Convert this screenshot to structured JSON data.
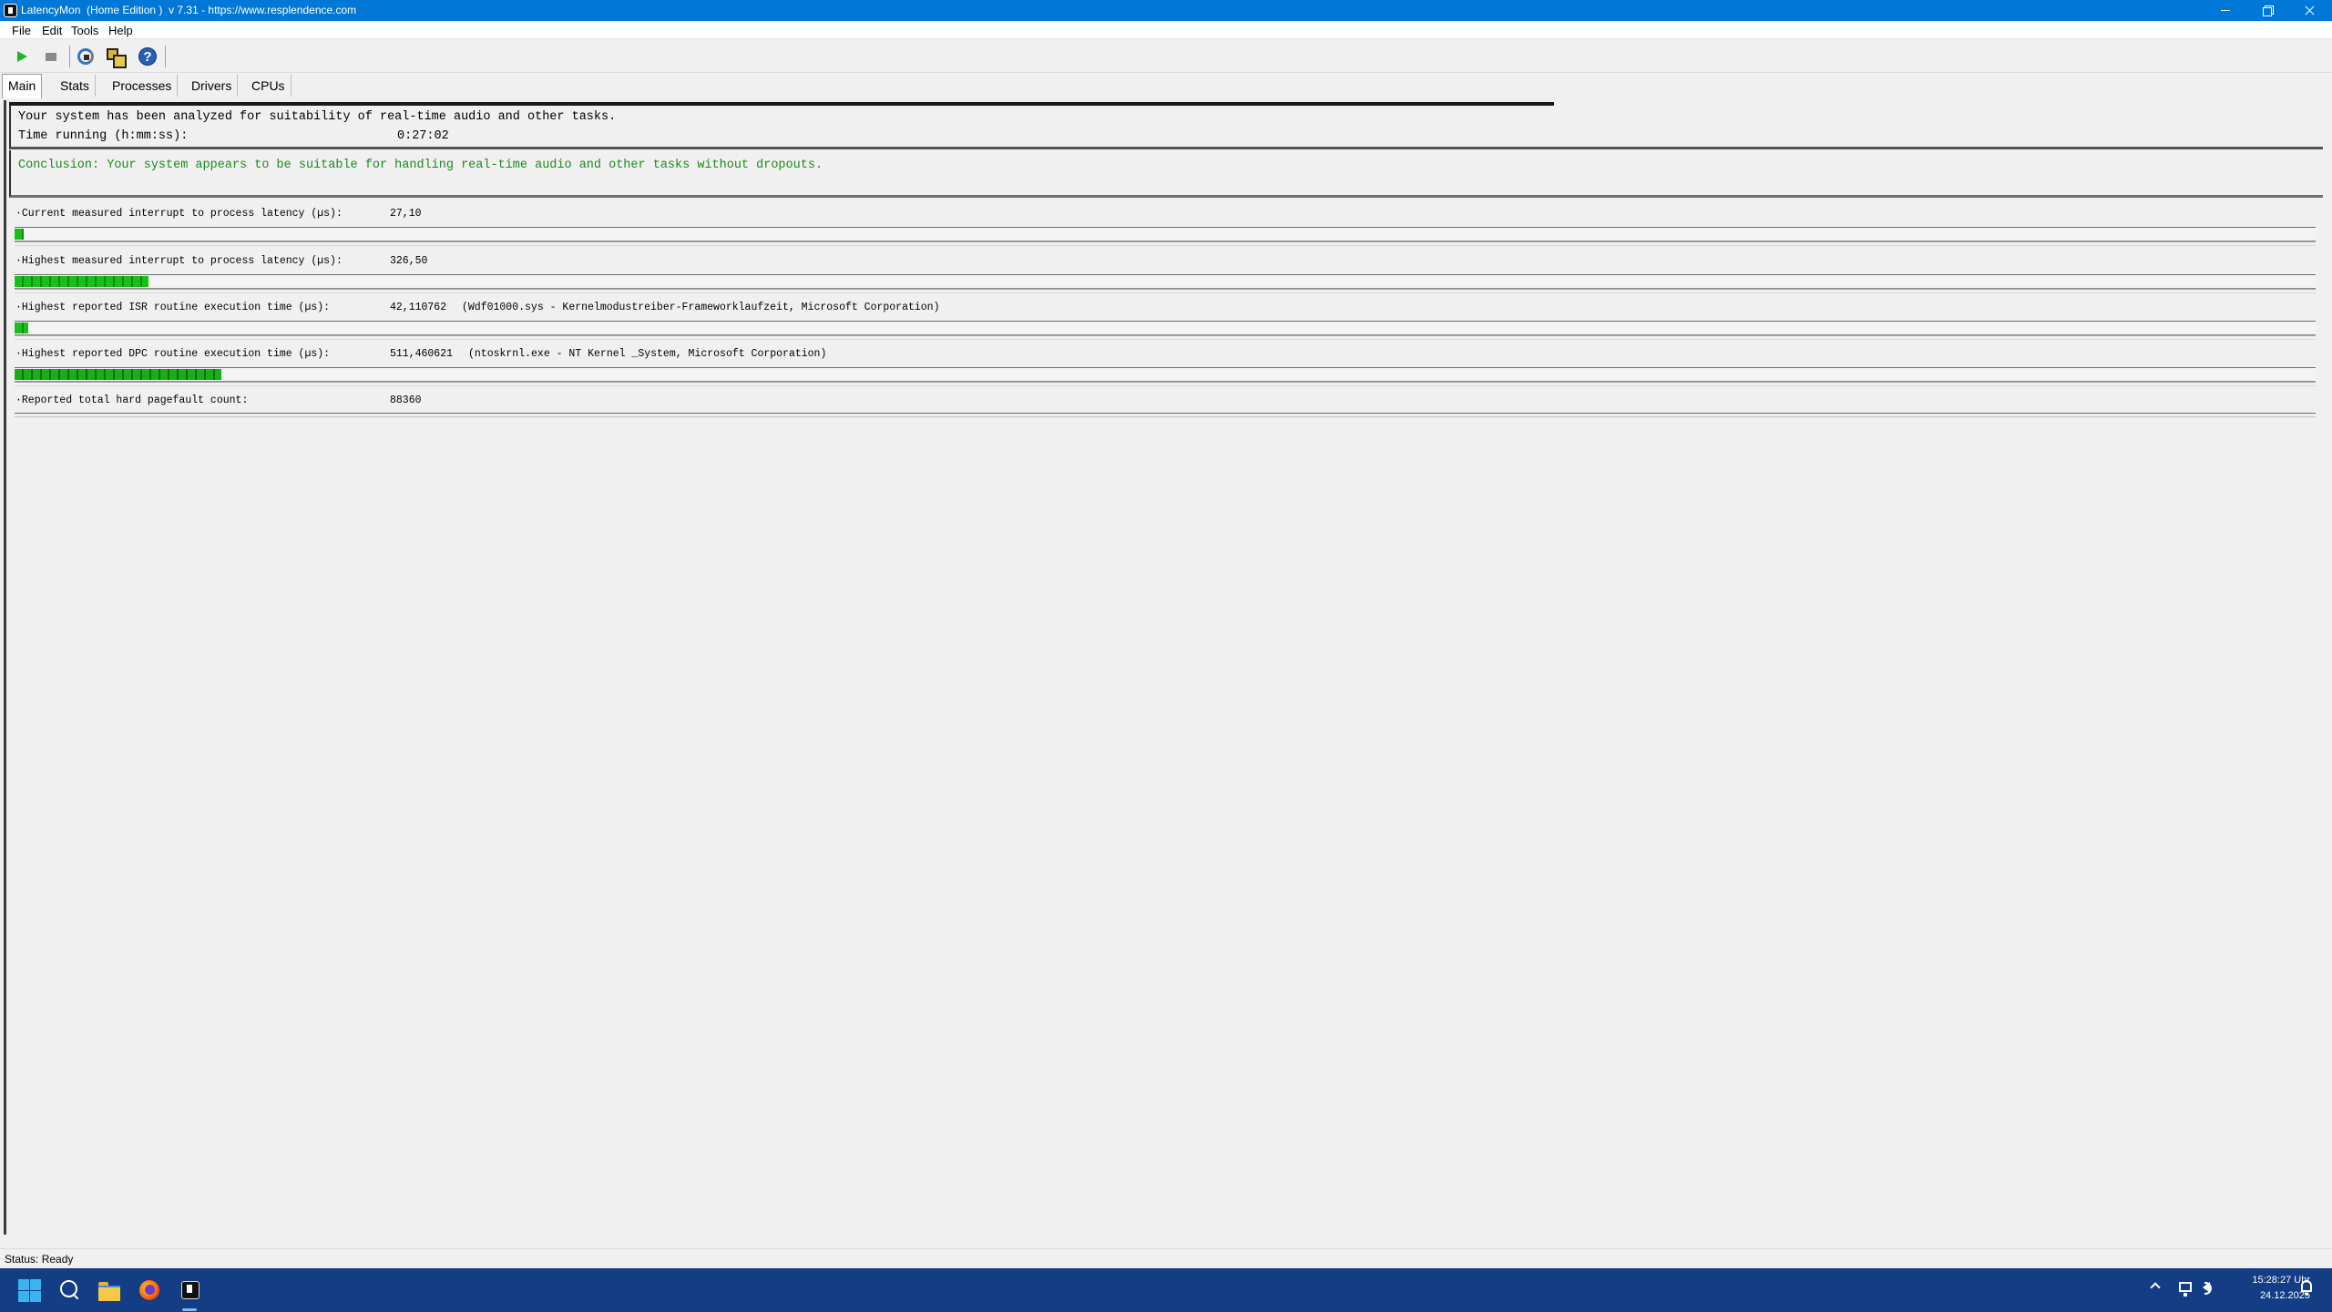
{
  "window": {
    "title": "LatencyMon  (Home Edition )  v 7.31 - https://www.resplendence.com"
  },
  "menu": {
    "items": [
      "File",
      "Edit",
      "Tools",
      "Help"
    ]
  },
  "toolbar": {
    "icons": [
      "play-icon",
      "stop-icon",
      "refresh-icon",
      "windows-icon",
      "help-icon"
    ]
  },
  "tabs": [
    {
      "label": "Main",
      "active": true
    },
    {
      "label": "Stats",
      "active": false
    },
    {
      "label": "Processes",
      "active": false
    },
    {
      "label": "Drivers",
      "active": false
    },
    {
      "label": "CPUs",
      "active": false
    }
  ],
  "summary": {
    "line1": "Your system has been analyzed for suitability of real-time audio and other tasks.",
    "time_label": "Time running (h:mm:ss):",
    "time_value": "0:27:02",
    "conclusion": "Conclusion: Your system appears to be suitable for handling real-time audio and other tasks without dropouts.",
    "conclusion_color": "#1d8a1d"
  },
  "metrics": [
    {
      "label": "·Current measured interrupt to process latency (µs):",
      "value": "27,10",
      "detail": "",
      "meter_fraction": 0.004
    },
    {
      "label": "·Highest measured interrupt to process latency (µs):",
      "value": "326,50",
      "detail": "",
      "meter_fraction": 0.058
    },
    {
      "label": "·Highest reported ISR routine execution time (µs):",
      "value": "42,110762",
      "detail": "(Wdf01000.sys - Kernelmodustreiber-Frameworklaufzeit, Microsoft Corporation)",
      "meter_fraction": 0.006
    },
    {
      "label": "·Highest reported DPC routine execution time (µs):",
      "value": "511,460621",
      "detail": "(ntoskrnl.exe - NT Kernel _System, Microsoft Corporation)",
      "meter_fraction": 0.09
    },
    {
      "label": "·Reported total hard pagefault count:",
      "value": "88360",
      "detail": ""
    }
  ],
  "status": {
    "text": "Status: Ready"
  },
  "taskbar": {
    "apps": [
      "windows-start-icon",
      "search-icon",
      "file-explorer-icon",
      "firefox-icon",
      "latencymon-icon"
    ],
    "time": "15:28:27 Uhr",
    "date": "24.12.2025"
  },
  "colors": {
    "titlebar": "#0078d7",
    "taskbar": "#133d84",
    "meter_green": "#19c019"
  }
}
